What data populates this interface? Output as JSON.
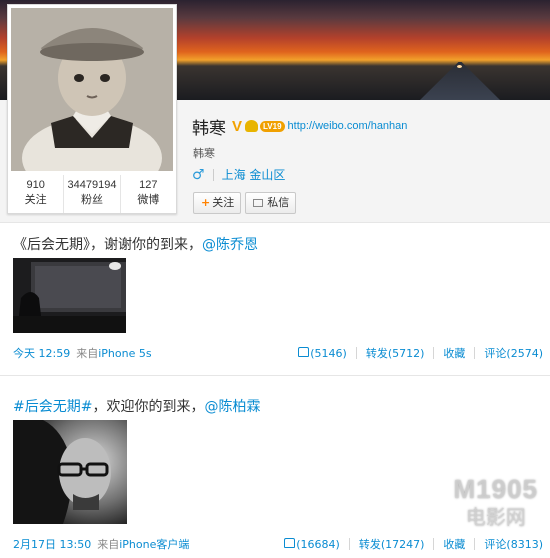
{
  "profile": {
    "name": "韩寒",
    "v_badge": "V",
    "level_badge": "LV19",
    "weibo_url": "http://weibo.com/hanhan",
    "subname": "韩寒",
    "gender_icon": "male-icon",
    "location": "上海 金山区",
    "follow_button": "关注",
    "message_button": "私信",
    "stats": [
      {
        "value": "910",
        "label": "关注"
      },
      {
        "value": "34479194",
        "label": "粉丝"
      },
      {
        "value": "127",
        "label": "微博"
      }
    ]
  },
  "posts": [
    {
      "text_prefix": "《后会无期》，谢谢你的到来，",
      "mention": "@陈乔恩",
      "time": "今天 12:59",
      "from_label": "来自",
      "from_source": "iPhone 5s",
      "likes": "(5146)",
      "repost_label": "转发(5712)",
      "favorite_label": "收藏",
      "comment_label": "评论(2574)"
    },
    {
      "tag": "#后会无期#",
      "text_middle": "，欢迎你的到来，",
      "mention": "@陈柏霖",
      "time": "2月17日 13:50",
      "from_label": "来自",
      "from_source": "iPhone客户端",
      "likes": "(16684)",
      "repost_label": "转发(17247)",
      "favorite_label": "收藏",
      "comment_label": "评论(8313)"
    }
  ],
  "watermark": {
    "top": "M1905",
    "bottom": "电影网"
  },
  "colors": {
    "link": "#0a8cd2",
    "accent_orange": "#ff8200",
    "v_gold": "#f2a200"
  }
}
